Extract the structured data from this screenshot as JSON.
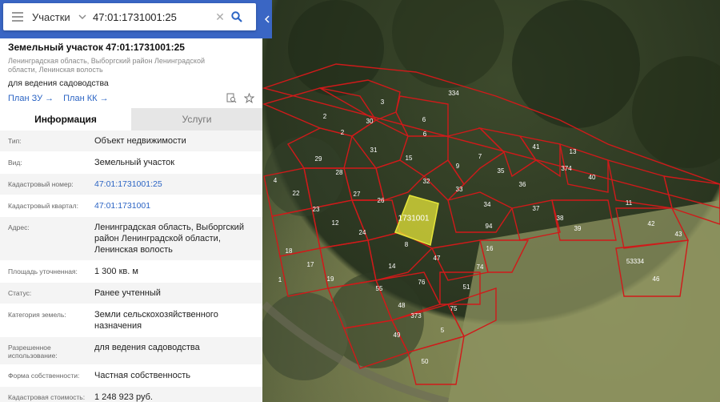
{
  "search": {
    "category": "Участки",
    "value": "47:01:1731001:25"
  },
  "panel": {
    "title": "Земельный участок 47:01:1731001:25",
    "address_short": "Ленинградская область, Выборгский район Ленинградской области, Ленинская волость",
    "purpose": "для ведения садоводства",
    "plan_zu": "План ЗУ →",
    "plan_kk": "План КК →",
    "tabs": [
      "Информация",
      "Услуги"
    ]
  },
  "rows": [
    {
      "label": "Тип:",
      "value": "Объект недвижимости",
      "link": false
    },
    {
      "label": "Вид:",
      "value": "Земельный участок",
      "link": false
    },
    {
      "label": "Кадастровый номер:",
      "value": "47:01:1731001:25",
      "link": true
    },
    {
      "label": "Кадастровый квартал:",
      "value": "47:01:1731001",
      "link": true
    },
    {
      "label": "Адрес:",
      "value": "Ленинградская область, Выборгский район Ленинградской области, Ленинская волость",
      "link": false
    },
    {
      "label": "Площадь уточненная:",
      "value": "1 300 кв. м",
      "link": false
    },
    {
      "label": "Статус:",
      "value": "Ранее учтенный",
      "link": false
    },
    {
      "label": "Категория земель:",
      "value": "Земли сельскохозяйственного назначения",
      "link": false
    },
    {
      "label": "Разрешенное использование:",
      "value": "для ведения садоводства",
      "link": false
    },
    {
      "label": "Форма собственности:",
      "value": "Частная собственность",
      "link": false
    },
    {
      "label": "Кадастровая стоимость:",
      "value": "1 248 923 руб.",
      "link": false
    }
  ],
  "map": {
    "highlight_label": "1731001",
    "parcel_numbers": [
      "334",
      "3",
      "6",
      "2",
      "30",
      "2",
      "31",
      "15",
      "6",
      "28",
      "29",
      "4",
      "22",
      "27",
      "26",
      "32",
      "33",
      "9",
      "7",
      "35",
      "36",
      "41",
      "13",
      "374",
      "40",
      "34",
      "37",
      "38",
      "39",
      "11",
      "42",
      "43",
      "23",
      "12",
      "24",
      "8",
      "16",
      "94",
      "18",
      "17",
      "19",
      "14",
      "47",
      "74",
      "55",
      "76",
      "51",
      "75",
      "48",
      "373",
      "5",
      "49",
      "50",
      "53334",
      "46",
      "1"
    ],
    "colors": {
      "parcel_border": "#d01a1a",
      "highlight_fill": "#e6e63a"
    }
  }
}
